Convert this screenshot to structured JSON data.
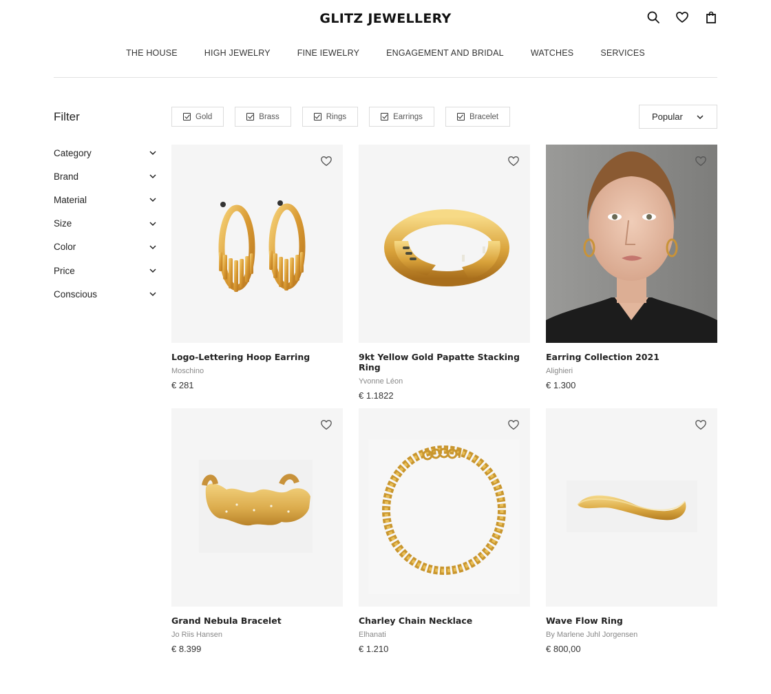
{
  "header": {
    "brand": "GLITZ JEWELLERY",
    "icons": [
      "search-icon",
      "heart-icon",
      "shopping-bag-icon"
    ]
  },
  "nav": {
    "items": [
      "THE HOUSE",
      "HIGH JEWELRY",
      "FINE IEWELRY",
      "ENGAGEMENT AND BRIDAL",
      "WATCHES",
      "SERVICES"
    ]
  },
  "sidebar": {
    "title": "Filter",
    "filters": [
      "Category",
      "Brand",
      "Material",
      "Size",
      "Color",
      "Price",
      "Conscious"
    ]
  },
  "chips": [
    "Gold",
    "Brass",
    "Rings",
    "Earrings",
    "Bracelet"
  ],
  "sort": {
    "label": "Popular"
  },
  "products": [
    {
      "name": "Logo-Lettering Hoop Earring",
      "brand": "Moschino",
      "price": "€ 281",
      "image": "gold-hoop-earrings"
    },
    {
      "name": "9kt Yellow Gold Papatte Stacking Ring",
      "brand": "Yvonne Léon",
      "price": "€ 1.1822",
      "image": "gold-hand-ring"
    },
    {
      "name": "Earring Collection 2021",
      "brand": "Alighieri",
      "price": "€ 1.300",
      "image": "model-portrait"
    },
    {
      "name": "Grand Nebula Bracelet",
      "brand": "Jo Riis Hansen",
      "price": "€ 8.399",
      "image": "gold-cuff-bracelet"
    },
    {
      "name": "Charley Chain Necklace",
      "brand": "Elhanati",
      "price": "€ 1.210",
      "image": "gold-chain-necklace"
    },
    {
      "name": "Wave Flow Ring",
      "brand": "By Marlene Juhl Jorgensen",
      "price": "€ 800,00",
      "image": "gold-wave-ring"
    }
  ],
  "colors": {
    "gold": "#d9a53a",
    "gold_light": "#f2cc6b",
    "thumb_bg": "#f5f5f5",
    "text": "#222222",
    "muted": "#888888"
  }
}
